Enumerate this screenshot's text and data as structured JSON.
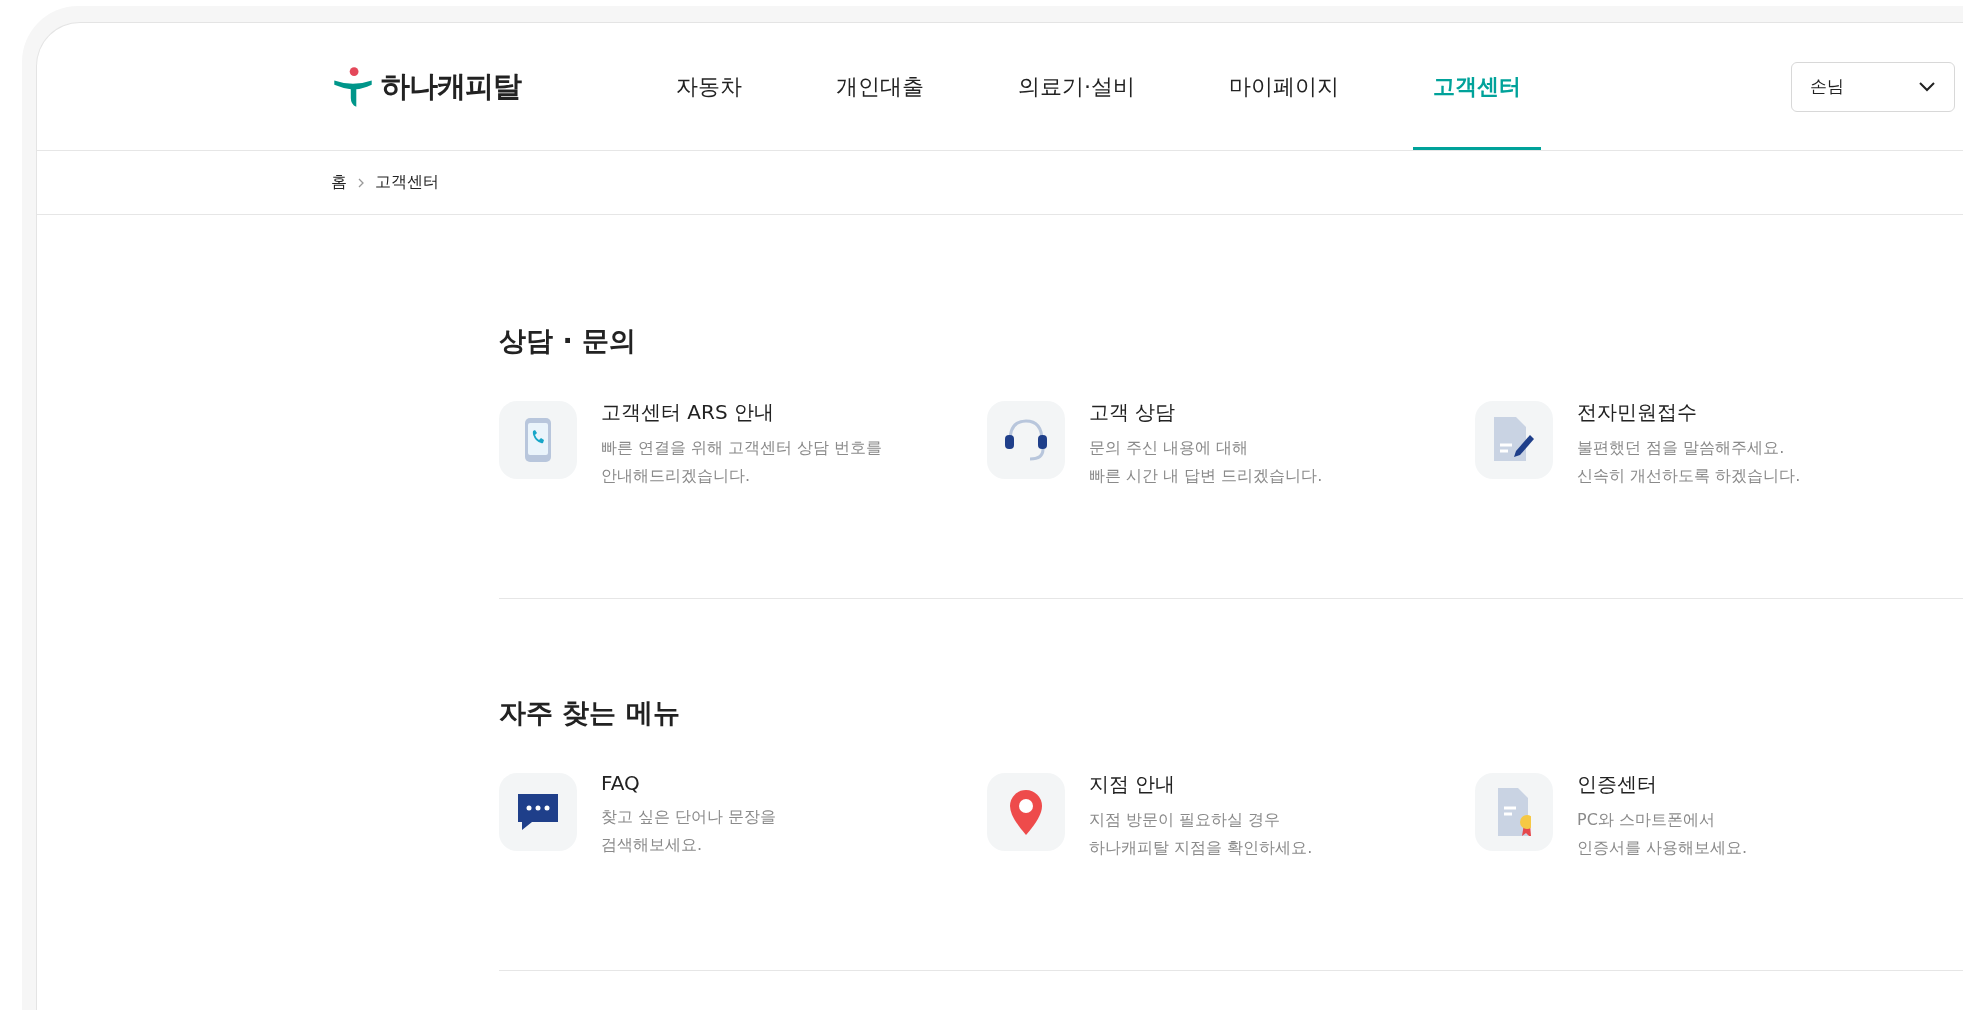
{
  "logo": {
    "text": "하나캐피탈"
  },
  "nav": [
    {
      "label": "자동차",
      "selected": false
    },
    {
      "label": "개인대출",
      "selected": false
    },
    {
      "label": "의료기·설비",
      "selected": false
    },
    {
      "label": "마이페이지",
      "selected": false
    },
    {
      "label": "고객센터",
      "selected": true
    }
  ],
  "user_menu": {
    "label": "손님"
  },
  "breadcrumb": [
    "홈",
    "고객센터"
  ],
  "sections": [
    {
      "title": "상담 · 문의",
      "items": [
        {
          "kind": "phone",
          "title": "고객센터 ARS 안내",
          "description": "빠른 연결을 위해 고객센터 상담 번호를\n안내해드리겠습니다."
        },
        {
          "kind": "headset",
          "title": "고객 상담",
          "description": "문의 주신 내용에 대해\n빠른 시간 내 답변 드리겠습니다."
        },
        {
          "kind": "document-pen",
          "title": "전자민원접수",
          "description": "불편했던 점을 말씀해주세요.\n신속히 개선하도록 하겠습니다."
        }
      ]
    },
    {
      "title": "자주 찾는 메뉴",
      "items": [
        {
          "kind": "chat",
          "title": "FAQ",
          "description": "찾고 싶은 단어나 문장을\n검색해보세요."
        },
        {
          "kind": "pin",
          "title": "지점 안내",
          "description": "지점 방문이 필요하실 경우\n하나캐피탈 지점을 확인하세요."
        },
        {
          "kind": "certificate",
          "title": "인증센터",
          "description": "PC와 스마트폰에서\n인증서를 사용해보세요."
        }
      ]
    }
  ]
}
